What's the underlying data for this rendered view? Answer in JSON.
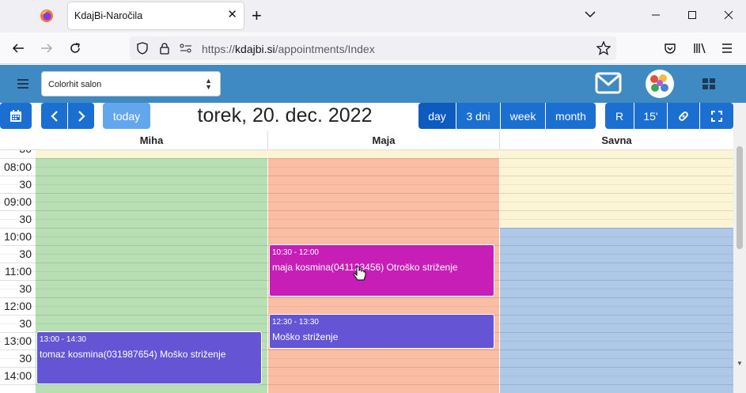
{
  "browser": {
    "tab_title": "KdajBi-Naročila",
    "url_prefix": "https://",
    "url_domain": "kdajbi.si",
    "url_path": "/appointments/Index"
  },
  "app": {
    "salon_select": "Colorhit salon"
  },
  "toolbar": {
    "today": "today",
    "title": "torek, 20. dec. 2022",
    "views": [
      "day",
      "3 dni",
      "week",
      "month"
    ],
    "active_view": "day",
    "r_label": "R",
    "slot_label": "15'"
  },
  "columns": [
    {
      "name": "Miha",
      "color": "#b8dfb3"
    },
    {
      "name": "Maja",
      "color": "#fbbea4"
    },
    {
      "name": "Savna",
      "color": "#fbf5d6"
    }
  ],
  "time_labels": [
    "08:00",
    "30",
    "09:00",
    "30",
    "10:00",
    "30",
    "11:00",
    "30",
    "12:00",
    "30",
    "13:00",
    "30",
    "14:00"
  ],
  "partial_top_label": "30",
  "events": [
    {
      "column": "Maja",
      "time": "10:30 - 12:00",
      "title": "maja kosmina(041123456) Otroško striženje",
      "color": "#c81eb8"
    },
    {
      "column": "Maja",
      "time": "12:30 - 13:30",
      "title": "Moško striženje",
      "color": "#6554d4"
    },
    {
      "column": "Miha",
      "time": "13:00 - 14:30",
      "title": "tomaz kosmina(031987654) Moško striženje",
      "color": "#6554d4"
    }
  ],
  "colors": {
    "appbar": "#3f8ac3",
    "button": "#1a6fd1",
    "button_active": "#0d5bbf",
    "savna_busy": "#aec8e8"
  }
}
